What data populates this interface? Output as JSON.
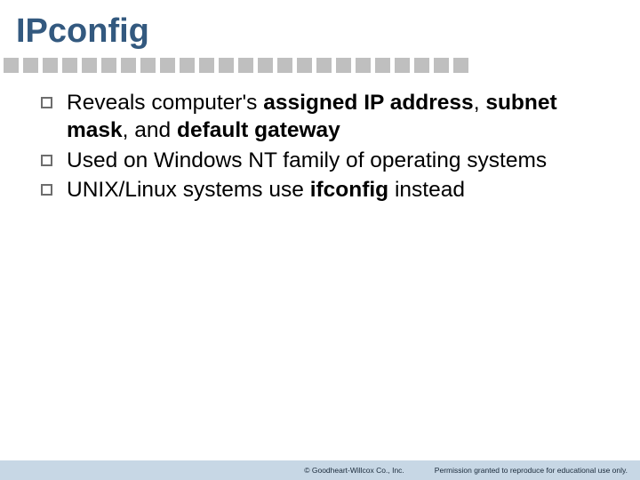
{
  "title": "IPconfig",
  "bullets": [
    {
      "html": "Reveals computer's <b>assigned IP address</b>, <b>subnet mask</b>, and <b>default gateway</b>"
    },
    {
      "html": "Used on Windows NT family of operating systems"
    },
    {
      "html": "UNIX/Linux systems use <b>ifconfig</b> instead"
    }
  ],
  "footer": {
    "copyright": "© Goodheart-Willcox Co., Inc.",
    "permission": "Permission granted to reproduce for educational use only."
  },
  "colors": {
    "title": "#33597f",
    "divider": "#bfbfbf",
    "footer_bg": "#c7d7e5"
  },
  "divider_count": 24
}
